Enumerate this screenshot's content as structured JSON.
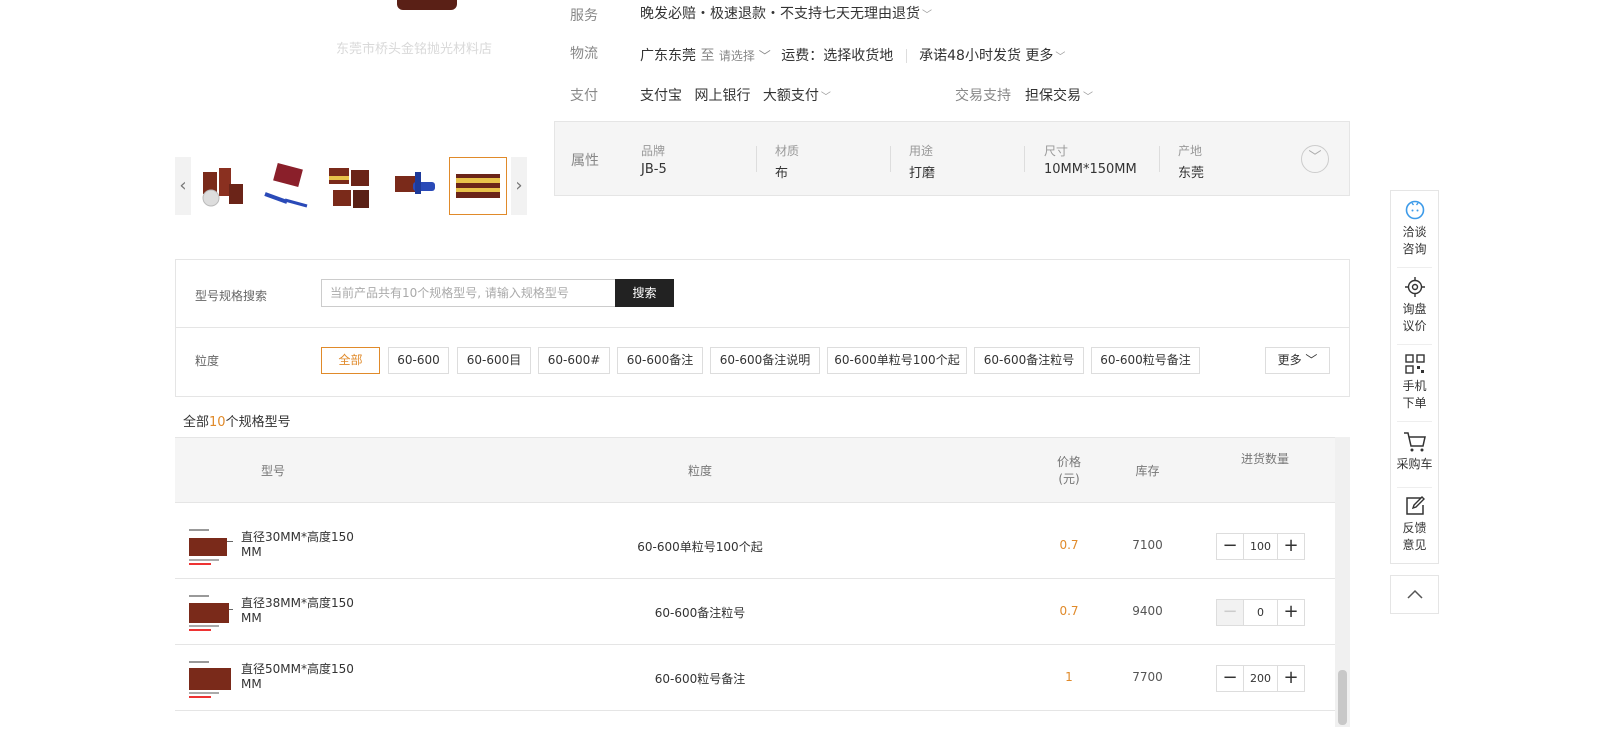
{
  "gallery": {
    "watermark": "东莞市桥头金铭抛光材料店",
    "prev_arrow": "‹",
    "next_arrow": "›",
    "thumbs": [
      "thumb-1",
      "thumb-2",
      "thumb-3",
      "thumb-4",
      "thumb-5"
    ],
    "active_thumb": 5
  },
  "service": {
    "label": "服务",
    "text": "晚发必赔・极速退款・不支持七天无理由退货"
  },
  "logistics": {
    "label": "物流",
    "origin": "广东东莞",
    "to": "至",
    "select": "请选择",
    "freight": "运费：选择收货地",
    "promise": "承诺48小时发货",
    "more": "更多"
  },
  "payment": {
    "label": "支付",
    "methods": [
      "支付宝",
      "网上银行",
      "大额支付"
    ],
    "trade_label": "交易支持",
    "trade_value": "担保交易"
  },
  "attributes": {
    "title": "属性",
    "items": [
      {
        "key": "品牌",
        "value": "JB-5"
      },
      {
        "key": "材质",
        "value": "布"
      },
      {
        "key": "用途",
        "value": "打磨"
      },
      {
        "key": "尺寸",
        "value": "10MM*150MM"
      },
      {
        "key": "产地",
        "value": "东莞"
      }
    ]
  },
  "filter": {
    "search_label": "型号规格搜索",
    "search_placeholder": "当前产品共有10个规格型号, 请输入规格型号",
    "search_button": "搜索",
    "grain_label": "粒度",
    "chips": [
      "全部",
      "60-600",
      "60-600目",
      "60-600#",
      "60-600备注",
      "60-600备注说明",
      "60-600单粒号100个起",
      "60-600备注粒号",
      "60-600粒号备注"
    ],
    "more": "更多"
  },
  "summary": {
    "prefix": "全部",
    "count": "10",
    "suffix": "个规格型号"
  },
  "table": {
    "headers": {
      "model": "型号",
      "grain": "粒度",
      "price": "价格\n(元)",
      "stock": "库存",
      "qty": "进货数量"
    },
    "rows": [
      {
        "model": "直径30MM*高度150MM",
        "grain": "60-600单粒号100个起",
        "price": "0.7",
        "stock": "7100",
        "qty": "100"
      },
      {
        "model": "直径38MM*高度150MM",
        "grain": "60-600备注粒号",
        "price": "0.7",
        "stock": "9400",
        "qty": "0"
      },
      {
        "model": "直径50MM*高度150MM",
        "grain": "60-600粒号备注",
        "price": "1",
        "stock": "7700",
        "qty": "200"
      }
    ]
  },
  "float_bar": {
    "items": [
      {
        "icon": "chat-icon",
        "label": "洽谈\n咨询"
      },
      {
        "icon": "target-icon",
        "label": "询盘\n议价"
      },
      {
        "icon": "qrcode-icon",
        "label": "手机\n下单"
      },
      {
        "icon": "cart-icon",
        "label": "采购车"
      },
      {
        "icon": "edit-icon",
        "label": "反馈\n意见"
      }
    ]
  },
  "colors": {
    "accent": "#e08a2a",
    "chat_blue": "#3d9be9"
  }
}
